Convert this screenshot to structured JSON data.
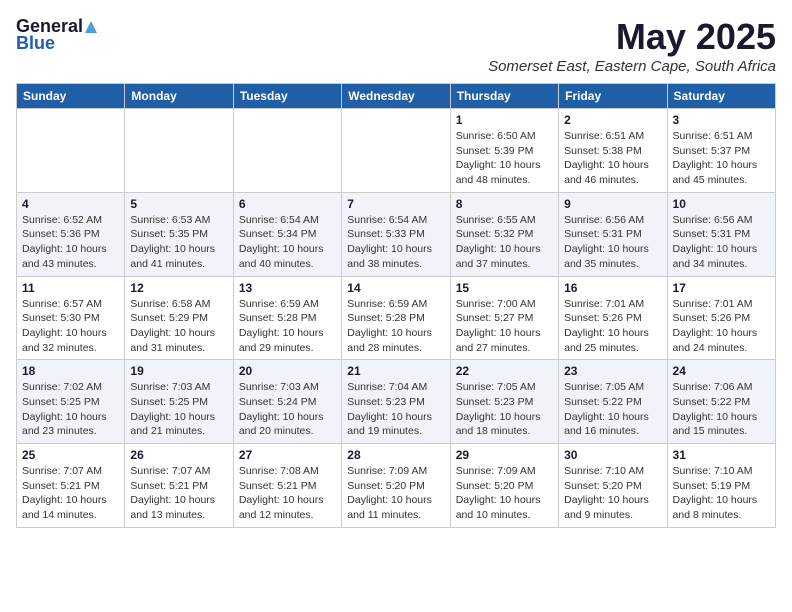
{
  "logo": {
    "general": "General",
    "blue": "Blue"
  },
  "header": {
    "month_title": "May 2025",
    "location": "Somerset East, Eastern Cape, South Africa"
  },
  "weekdays": [
    "Sunday",
    "Monday",
    "Tuesday",
    "Wednesday",
    "Thursday",
    "Friday",
    "Saturday"
  ],
  "weeks": [
    [
      {
        "day": "",
        "info": ""
      },
      {
        "day": "",
        "info": ""
      },
      {
        "day": "",
        "info": ""
      },
      {
        "day": "",
        "info": ""
      },
      {
        "day": "1",
        "info": "Sunrise: 6:50 AM\nSunset: 5:39 PM\nDaylight: 10 hours\nand 48 minutes."
      },
      {
        "day": "2",
        "info": "Sunrise: 6:51 AM\nSunset: 5:38 PM\nDaylight: 10 hours\nand 46 minutes."
      },
      {
        "day": "3",
        "info": "Sunrise: 6:51 AM\nSunset: 5:37 PM\nDaylight: 10 hours\nand 45 minutes."
      }
    ],
    [
      {
        "day": "4",
        "info": "Sunrise: 6:52 AM\nSunset: 5:36 PM\nDaylight: 10 hours\nand 43 minutes."
      },
      {
        "day": "5",
        "info": "Sunrise: 6:53 AM\nSunset: 5:35 PM\nDaylight: 10 hours\nand 41 minutes."
      },
      {
        "day": "6",
        "info": "Sunrise: 6:54 AM\nSunset: 5:34 PM\nDaylight: 10 hours\nand 40 minutes."
      },
      {
        "day": "7",
        "info": "Sunrise: 6:54 AM\nSunset: 5:33 PM\nDaylight: 10 hours\nand 38 minutes."
      },
      {
        "day": "8",
        "info": "Sunrise: 6:55 AM\nSunset: 5:32 PM\nDaylight: 10 hours\nand 37 minutes."
      },
      {
        "day": "9",
        "info": "Sunrise: 6:56 AM\nSunset: 5:31 PM\nDaylight: 10 hours\nand 35 minutes."
      },
      {
        "day": "10",
        "info": "Sunrise: 6:56 AM\nSunset: 5:31 PM\nDaylight: 10 hours\nand 34 minutes."
      }
    ],
    [
      {
        "day": "11",
        "info": "Sunrise: 6:57 AM\nSunset: 5:30 PM\nDaylight: 10 hours\nand 32 minutes."
      },
      {
        "day": "12",
        "info": "Sunrise: 6:58 AM\nSunset: 5:29 PM\nDaylight: 10 hours\nand 31 minutes."
      },
      {
        "day": "13",
        "info": "Sunrise: 6:59 AM\nSunset: 5:28 PM\nDaylight: 10 hours\nand 29 minutes."
      },
      {
        "day": "14",
        "info": "Sunrise: 6:59 AM\nSunset: 5:28 PM\nDaylight: 10 hours\nand 28 minutes."
      },
      {
        "day": "15",
        "info": "Sunrise: 7:00 AM\nSunset: 5:27 PM\nDaylight: 10 hours\nand 27 minutes."
      },
      {
        "day": "16",
        "info": "Sunrise: 7:01 AM\nSunset: 5:26 PM\nDaylight: 10 hours\nand 25 minutes."
      },
      {
        "day": "17",
        "info": "Sunrise: 7:01 AM\nSunset: 5:26 PM\nDaylight: 10 hours\nand 24 minutes."
      }
    ],
    [
      {
        "day": "18",
        "info": "Sunrise: 7:02 AM\nSunset: 5:25 PM\nDaylight: 10 hours\nand 23 minutes."
      },
      {
        "day": "19",
        "info": "Sunrise: 7:03 AM\nSunset: 5:25 PM\nDaylight: 10 hours\nand 21 minutes."
      },
      {
        "day": "20",
        "info": "Sunrise: 7:03 AM\nSunset: 5:24 PM\nDaylight: 10 hours\nand 20 minutes."
      },
      {
        "day": "21",
        "info": "Sunrise: 7:04 AM\nSunset: 5:23 PM\nDaylight: 10 hours\nand 19 minutes."
      },
      {
        "day": "22",
        "info": "Sunrise: 7:05 AM\nSunset: 5:23 PM\nDaylight: 10 hours\nand 18 minutes."
      },
      {
        "day": "23",
        "info": "Sunrise: 7:05 AM\nSunset: 5:22 PM\nDaylight: 10 hours\nand 16 minutes."
      },
      {
        "day": "24",
        "info": "Sunrise: 7:06 AM\nSunset: 5:22 PM\nDaylight: 10 hours\nand 15 minutes."
      }
    ],
    [
      {
        "day": "25",
        "info": "Sunrise: 7:07 AM\nSunset: 5:21 PM\nDaylight: 10 hours\nand 14 minutes."
      },
      {
        "day": "26",
        "info": "Sunrise: 7:07 AM\nSunset: 5:21 PM\nDaylight: 10 hours\nand 13 minutes."
      },
      {
        "day": "27",
        "info": "Sunrise: 7:08 AM\nSunset: 5:21 PM\nDaylight: 10 hours\nand 12 minutes."
      },
      {
        "day": "28",
        "info": "Sunrise: 7:09 AM\nSunset: 5:20 PM\nDaylight: 10 hours\nand 11 minutes."
      },
      {
        "day": "29",
        "info": "Sunrise: 7:09 AM\nSunset: 5:20 PM\nDaylight: 10 hours\nand 10 minutes."
      },
      {
        "day": "30",
        "info": "Sunrise: 7:10 AM\nSunset: 5:20 PM\nDaylight: 10 hours\nand 9 minutes."
      },
      {
        "day": "31",
        "info": "Sunrise: 7:10 AM\nSunset: 5:19 PM\nDaylight: 10 hours\nand 8 minutes."
      }
    ]
  ]
}
